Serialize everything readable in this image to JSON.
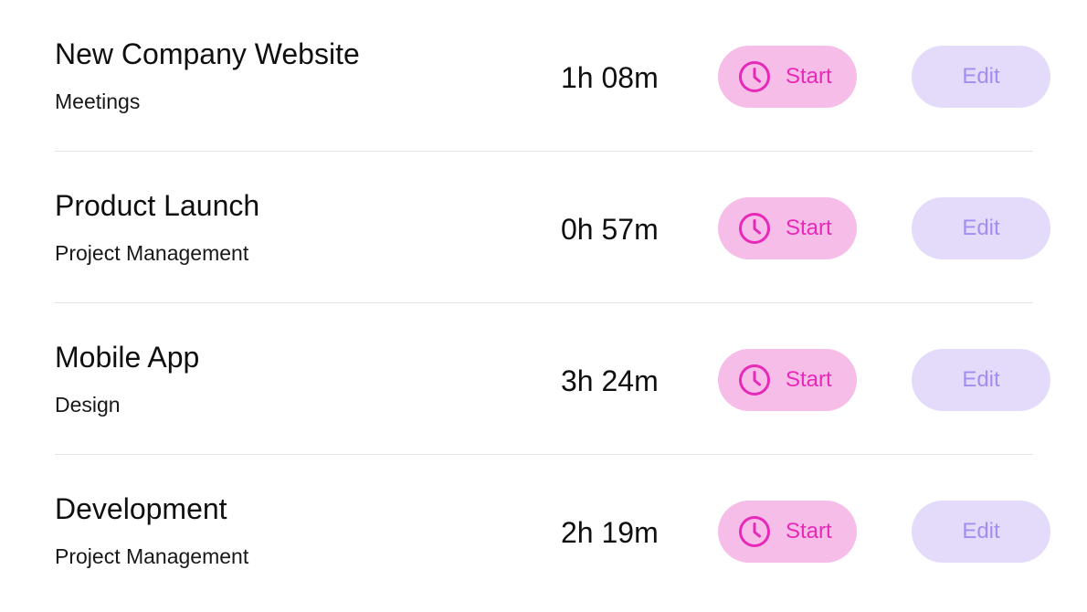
{
  "colors": {
    "start_bg": "#f6bde9",
    "start_fg": "#e62ab7",
    "edit_bg": "#e4dbfb",
    "edit_fg": "#a58cf0",
    "divider": "#e4e4e7"
  },
  "icons": {
    "start": "clock-icon"
  },
  "entries": [
    {
      "title": "New Company Website",
      "category": "Meetings",
      "duration": "1h 08m",
      "start_label": "Start",
      "edit_label": "Edit"
    },
    {
      "title": "Product Launch",
      "category": "Project Management",
      "duration": "0h 57m",
      "start_label": "Start",
      "edit_label": "Edit"
    },
    {
      "title": "Mobile App",
      "category": "Design",
      "duration": "3h 24m",
      "start_label": "Start",
      "edit_label": "Edit"
    },
    {
      "title": "Development",
      "category": "Project Management",
      "duration": "2h 19m",
      "start_label": "Start",
      "edit_label": "Edit"
    }
  ]
}
